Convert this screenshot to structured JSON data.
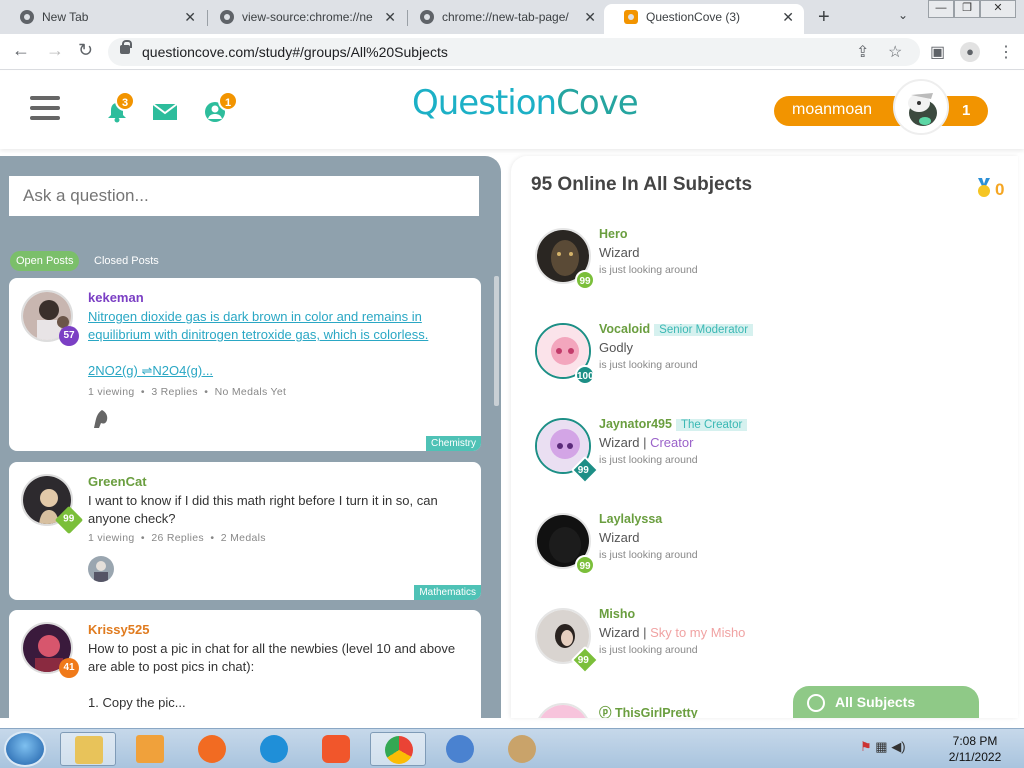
{
  "browser": {
    "tabs": [
      {
        "title": "New Tab"
      },
      {
        "title": "view-source:chrome://ne"
      },
      {
        "title": "chrome://new-tab-page/"
      },
      {
        "title": "QuestionCove (3)"
      }
    ],
    "new_tab_label": "+",
    "url": "questioncove.com/study#/groups/All%20Subjects"
  },
  "header": {
    "logo_text_a": "Question",
    "logo_text_b": "Cove",
    "notifications_count": "3",
    "friends_count": "1",
    "username": "moanmoan",
    "user_count": "1"
  },
  "left": {
    "ask_placeholder": "Ask a question...",
    "filters": {
      "open": "Open Posts",
      "closed": "Closed Posts"
    },
    "posts": [
      {
        "user": "kekeman",
        "level": "57",
        "level_color": "#7b3fc4",
        "name_color": "#7b3fc4",
        "text_line1": "Nitrogen dioxide gas is dark brown in color and remains in",
        "text_line2": "equilibrium with dinitrogen tetroxide gas, which is colorless.",
        "text_line3": "2NO2(g) ⇌N2O4(g)...",
        "meta": "1 viewing  •  3 Replies  •  No Medals Yet",
        "tag": "Chemistry",
        "tag_color": "#4fc2b6"
      },
      {
        "user": "GreenCat",
        "level": "99",
        "level_color": "#7bbf3a",
        "name_color": "#6a9e3f",
        "text": "I want to know if I did this math right before I turn it in so, can anyone check?",
        "meta": "1 viewing  •  26 Replies  •  2 Medals",
        "tag": "Mathematics",
        "tag_color": "#4fc2b6"
      },
      {
        "user": "Krissy525",
        "level": "41",
        "level_color": "#f07a1a",
        "name_color": "#e07b1f",
        "text": "How to post a pic in chat for all the newbies (level 10 and above are able to post pics in chat):",
        "text2": "1. Copy the pic..."
      }
    ]
  },
  "right": {
    "title": "95 Online In All Subjects",
    "medal_count": "0",
    "users": [
      {
        "name": "Hero",
        "role": "Wizard",
        "extra": "",
        "tag": "",
        "level": "99",
        "level_color": "#7bbf3a",
        "status": "is just looking around"
      },
      {
        "name": "Vocaloid",
        "role": "Godly",
        "extra": "",
        "tag": "Senior Moderator",
        "level": "100",
        "level_color": "#1d8f86",
        "status": "is just looking around"
      },
      {
        "name": "Jaynator495",
        "role": "Wizard",
        "extra": "Creator",
        "tag": "The Creator",
        "level": "99",
        "level_color": "#1d8f86",
        "status": "is just looking around"
      },
      {
        "name": "Laylalyssa",
        "role": "Wizard",
        "extra": "",
        "tag": "",
        "level": "99",
        "level_color": "#7bbf3a",
        "status": "is just looking around"
      },
      {
        "name": "Misho",
        "role": "Wizard",
        "extra": "Sky to my Misho",
        "tag": "",
        "level": "99",
        "level_color": "#7bbf3a",
        "status": "is just looking around"
      },
      {
        "name": "ThisGirlPretty",
        "role": "",
        "extra": "",
        "tag": "",
        "level": "",
        "level_color": "#7bbf3a",
        "status": ""
      }
    ],
    "all_subjects": "All Subjects"
  },
  "taskbar": {
    "time": "7:08 PM",
    "date": "2/11/2022"
  },
  "colors": {
    "accent_orange": "#f29400",
    "brand_teal": "#1cb0c6",
    "green": "#7bbf6a",
    "panel_slate": "#8fa1ad"
  }
}
